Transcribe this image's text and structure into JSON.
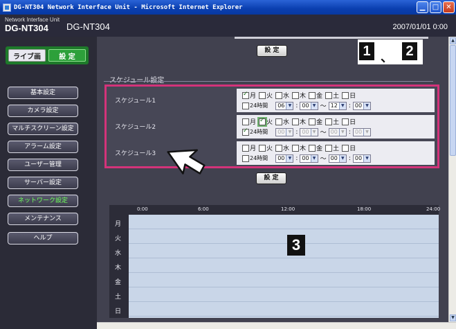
{
  "window": {
    "title": "DG-NT304 Network Interface Unit - Microsoft Internet Explorer",
    "buttons": [
      "minimize",
      "maximize",
      "close"
    ]
  },
  "header": {
    "subtitle": "Network Interface Unit",
    "model": "DG-NT304",
    "model_label": "DG-NT304",
    "datetime": "2007/01/01  0:00"
  },
  "mode": {
    "live": "ライブ画",
    "setup": "設 定"
  },
  "menu": {
    "items": [
      {
        "label": "基本設定"
      },
      {
        "label": "カメラ設定"
      },
      {
        "label": "マルチスクリーン設定"
      },
      {
        "label": "アラーム設定"
      },
      {
        "label": "ユーザー管理"
      },
      {
        "label": "サーバー設定"
      },
      {
        "label": "ネットワーク設定"
      },
      {
        "label": "メンテナンス"
      },
      {
        "label": "ヘルプ"
      }
    ],
    "active_index": 6
  },
  "callouts": {
    "marker1": "1",
    "comma": "、",
    "marker2": "2",
    "marker3": "3"
  },
  "set_button_label": "設 定",
  "schedule": {
    "section_title": "スケジュール設定",
    "day_labels": [
      "月",
      "火",
      "水",
      "木",
      "金",
      "土",
      "日"
    ],
    "label_24h": "24時間",
    "tilde": "～",
    "colon": ":",
    "rows": [
      {
        "label": "スケジュール1",
        "checked": [
          true,
          false,
          false,
          false,
          false,
          false,
          false
        ],
        "h24": false,
        "from_h": "06",
        "from_m": "00",
        "to_h": "12",
        "to_m": "00"
      },
      {
        "label": "スケジュール2",
        "checked": [
          false,
          true,
          false,
          false,
          false,
          false,
          false
        ],
        "h24": true,
        "from_h": "00",
        "from_m": "00",
        "to_h": "00",
        "to_m": "00"
      },
      {
        "label": "スケジュール3",
        "checked": [
          false,
          false,
          false,
          false,
          false,
          false,
          false
        ],
        "h24": false,
        "from_h": "00",
        "from_m": "00",
        "to_h": "00",
        "to_m": "00"
      }
    ]
  },
  "timeline": {
    "time_labels": [
      "0:00",
      "6:00",
      "12:00",
      "18:00",
      "24:00"
    ],
    "days": [
      "月",
      "火",
      "水",
      "木",
      "金",
      "土",
      "日"
    ]
  },
  "colors": {
    "accent": "#d4337a",
    "menu_active": "#6cff5a",
    "setup_green": "#2da03a"
  }
}
